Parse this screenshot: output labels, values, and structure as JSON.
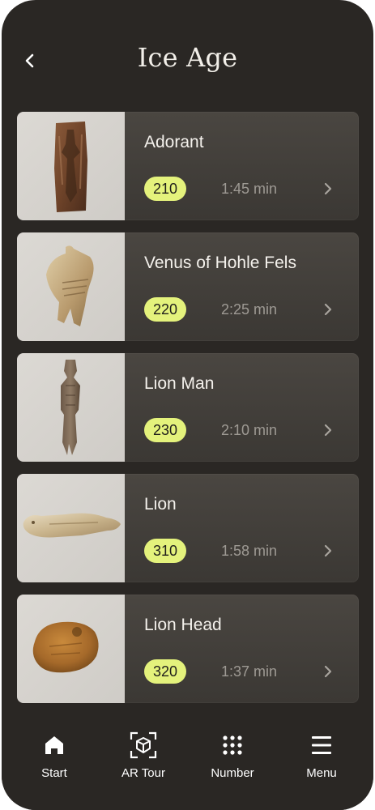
{
  "header": {
    "title": "Ice Age",
    "back_icon": "chevron-left-icon"
  },
  "items": [
    {
      "title": "Adorant",
      "number": "210",
      "duration": "1:45 min",
      "artifact": "adorant-ivory-plate"
    },
    {
      "title": "Venus of Hohle Fels",
      "number": "220",
      "duration": "2:25 min",
      "artifact": "venus-figurine"
    },
    {
      "title": "Lion Man",
      "number": "230",
      "duration": "2:10 min",
      "artifact": "lion-man-figurine"
    },
    {
      "title": "Lion",
      "number": "310",
      "duration": "1:58 min",
      "artifact": "lion-figurine"
    },
    {
      "title": "Lion Head",
      "number": "320",
      "duration": "1:37 min",
      "artifact": "lion-head-carving"
    }
  ],
  "tabbar": {
    "tabs": [
      {
        "label": "Start",
        "icon": "home-icon"
      },
      {
        "label": "AR Tour",
        "icon": "ar-cube-icon"
      },
      {
        "label": "Number",
        "icon": "keypad-icon"
      },
      {
        "label": "Menu",
        "icon": "menu-icon"
      }
    ]
  },
  "colors": {
    "background": "#2a2724",
    "card": "#423f3a",
    "badge": "#e4f27c",
    "text": "#f4f1ec",
    "muted": "#9e9a94"
  }
}
